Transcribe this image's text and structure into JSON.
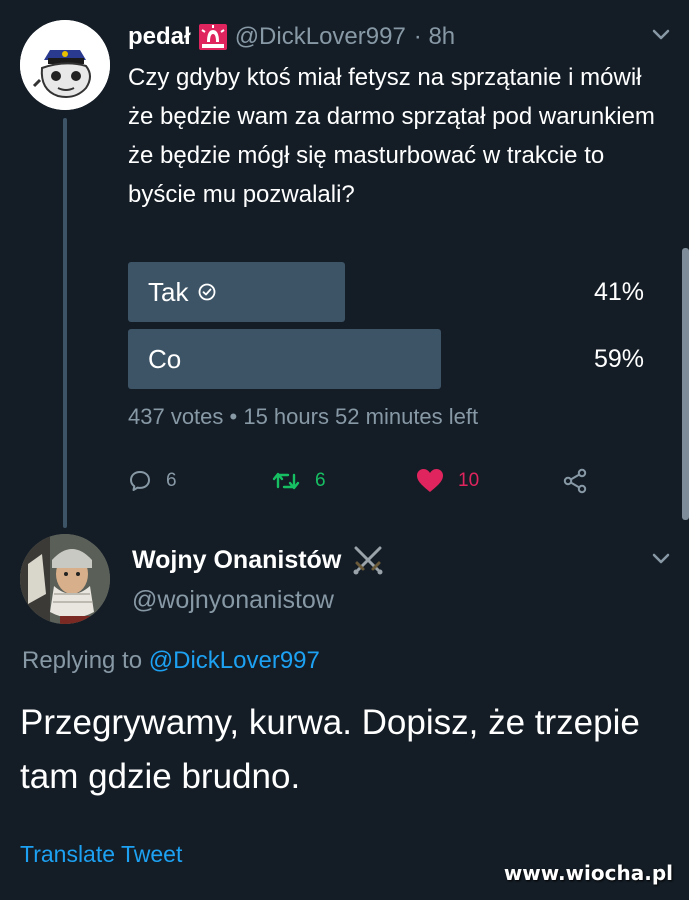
{
  "tweet": {
    "author_name": "pedał",
    "handle": "@DickLover997",
    "time": "· 8h",
    "avatar_icon": "cartoon-avatar-icon",
    "badge_icon": "siren-emoji-icon",
    "text": "Czy gdyby ktoś miał fetysz na sprzątanie i mówił że będzie wam za darmo sprzątał pod warunkiem że będzie mógł się masturbować w trakcie to byście mu pozwalali?",
    "poll": {
      "options": [
        {
          "label": "Tak",
          "percent_label": "41%",
          "percent": 41,
          "selected": true
        },
        {
          "label": "Co",
          "percent_label": "59%",
          "percent": 59,
          "selected": false
        }
      ],
      "meta": "437 votes • 15 hours 52 minutes left"
    },
    "actions": {
      "replies": "6",
      "retweets": "6",
      "likes": "10"
    }
  },
  "reply": {
    "author_name": "Wojny Onanistów",
    "badge_icon": "crossed-swords-icon",
    "handle": "@wojnyonanistow",
    "replying_prefix": "Replying to",
    "replying_to": "@DickLover997",
    "text": "Przegrywamy, kurwa. Dopisz, że trzepie tam gdzie brudno.",
    "translate_label": "Translate Tweet"
  },
  "watermark": "www.wiocha.pl",
  "colors": {
    "background": "#141d26",
    "bar": "#3d5466",
    "muted": "#8899a6",
    "link": "#1da1f2",
    "retweet": "#17bf63",
    "like": "#e0245e"
  }
}
